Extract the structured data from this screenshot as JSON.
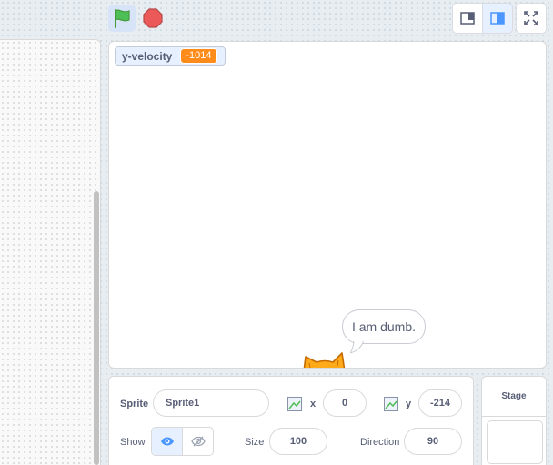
{
  "controls": {
    "green_flag_icon": "green-flag-icon",
    "stop_icon": "stop-sign-icon",
    "small_stage_icon": "small-stage-icon",
    "normal_stage_icon": "normal-stage-icon",
    "fullscreen_icon": "fullscreen-icon"
  },
  "stage": {
    "monitor": {
      "label": "y-velocity",
      "value": "-1014"
    },
    "speech_bubble": "I am dumb."
  },
  "sprite_info": {
    "sprite_label": "Sprite",
    "sprite_name": "Sprite1",
    "x_label": "x",
    "x_value": "0",
    "y_label": "y",
    "y_value": "-214",
    "show_label": "Show",
    "size_label": "Size",
    "size_value": "100",
    "direction_label": "Direction",
    "direction_value": "90"
  },
  "stage_panel": {
    "title": "Stage"
  },
  "colors": {
    "accent": "#4c97ff",
    "monitor_value_bg": "#ff8c1a",
    "stop_red": "#ec5959",
    "flag_green": "#4cbf56",
    "text": "#575e75"
  }
}
